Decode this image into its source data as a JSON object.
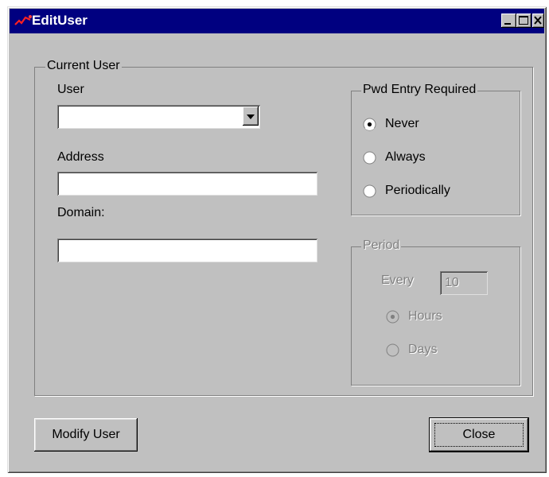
{
  "window": {
    "title": "EditUser"
  },
  "current_user_group": {
    "legend": "Current User",
    "user_label": "User",
    "user_value": "",
    "address_label": "Address",
    "address_value": "",
    "domain_label": "Domain:",
    "domain_value": ""
  },
  "pwd_group": {
    "legend": "Pwd Entry Required",
    "options": [
      "Never",
      "Always",
      "Periodically"
    ],
    "selected": "Never"
  },
  "period_group": {
    "legend": "Period",
    "every_label": "Every",
    "every_value": "10",
    "options": [
      "Hours",
      "Days"
    ],
    "selected": "Hours",
    "enabled": false
  },
  "buttons": {
    "modify_label": "Modify User",
    "close_label": "Close"
  }
}
